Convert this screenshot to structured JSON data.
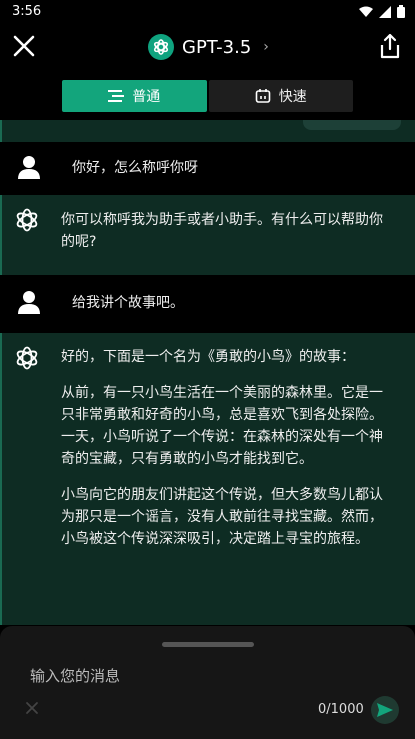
{
  "status_bar": {
    "time": "3:56"
  },
  "header": {
    "title": "GPT-3.5",
    "icons": [
      "close-icon",
      "openai-logo-icon",
      "chevron-right-icon",
      "share-icon"
    ]
  },
  "mode_tabs": [
    {
      "label": "普通",
      "icon": "list-icon",
      "active": true
    },
    {
      "label": "快速",
      "icon": "timer-icon",
      "active": false
    }
  ],
  "messages": [
    {
      "role": "user",
      "text": "你好，怎么称呼你呀"
    },
    {
      "role": "assistant",
      "text": "你可以称呼我为助手或者小助手。有什么可以帮助你的呢?"
    },
    {
      "role": "user",
      "text": "给我讲个故事吧。"
    },
    {
      "role": "assistant",
      "paragraphs": [
        "好的，下面是一个名为《勇敢的小鸟》的故事：",
        "从前，有一只小鸟生活在一个美丽的森林里。它是一只非常勇敢和好奇的小鸟，总是喜欢飞到各处探险。一天，小鸟听说了一个传说：在森林的深处有一个神奇的宝藏，只有勇敢的小鸟才能找到它。",
        "小鸟向它的朋友们讲起这个传说，但大多数鸟儿都认为那只是一个谣言，没有人敢前往寻找宝藏。然而，小鸟被这个传说深深吸引，决定踏上寻宝的旅程。"
      ]
    }
  ],
  "input": {
    "placeholder": "输入您的消息",
    "counter": "0/1000"
  },
  "colors": {
    "accent": "#13a57c",
    "ai_bg": "#0e2c23",
    "page_bg": "#000000"
  }
}
